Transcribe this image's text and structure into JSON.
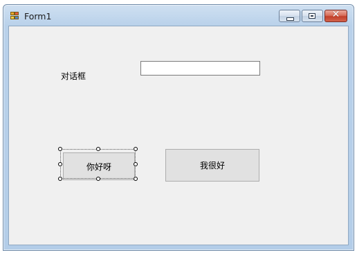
{
  "window": {
    "title": "Form1",
    "app_icon": "winforms-form-icon",
    "controls": {
      "minimize_icon": "minimize-icon",
      "maximize_icon": "maximize-icon",
      "close_icon": "close-icon",
      "close_glyph": "✕"
    }
  },
  "form": {
    "label_text": "对话框",
    "textbox_value": "",
    "button1_label": "你好呀",
    "button2_label": "我很好"
  }
}
